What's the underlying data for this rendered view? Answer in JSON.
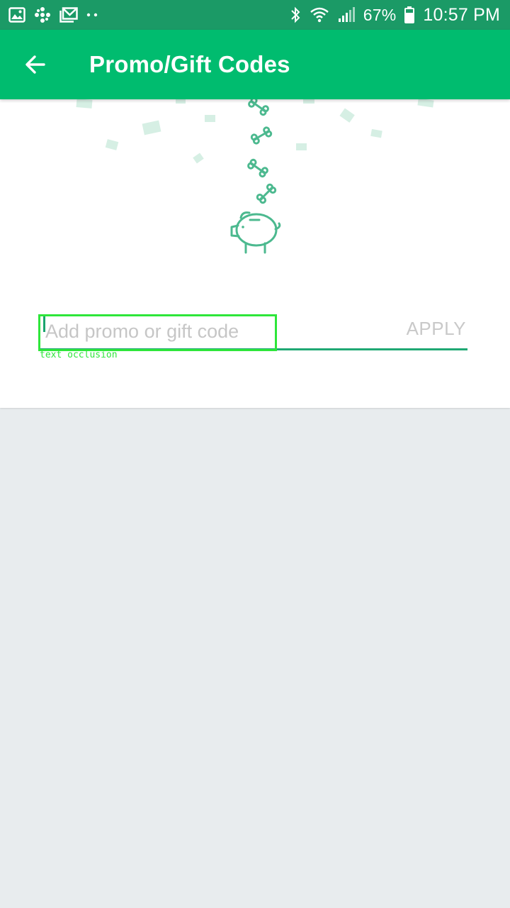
{
  "status_bar": {
    "left_icons": [
      "image-icon",
      "fan-icon",
      "mail-icon",
      "more-dots-icon"
    ],
    "right_icons": [
      "bluetooth-icon",
      "wifi-icon",
      "signal-icon",
      "battery-icon"
    ],
    "battery": "67%",
    "time": "10:57 PM"
  },
  "app_bar": {
    "back_icon": "back-arrow-icon",
    "title": "Promo/Gift Codes"
  },
  "promo": {
    "placeholder": "Add promo or gift code",
    "value": "",
    "apply_label": "APPLY"
  },
  "illustration": {
    "icons": [
      "bone-icon",
      "bone-icon",
      "bone-icon",
      "bone-icon",
      "piggy-bank-icon",
      "confetti"
    ]
  },
  "annotation": {
    "label": "text occlusion"
  },
  "colors": {
    "status_bar": "#1b9a66",
    "app_bar": "#00bc6f",
    "accent": "#1fa874",
    "illustration_line": "#4cb98f",
    "confetti": "#d6efe4",
    "background": "#e8ecee",
    "annotation": "#2ee63a"
  }
}
